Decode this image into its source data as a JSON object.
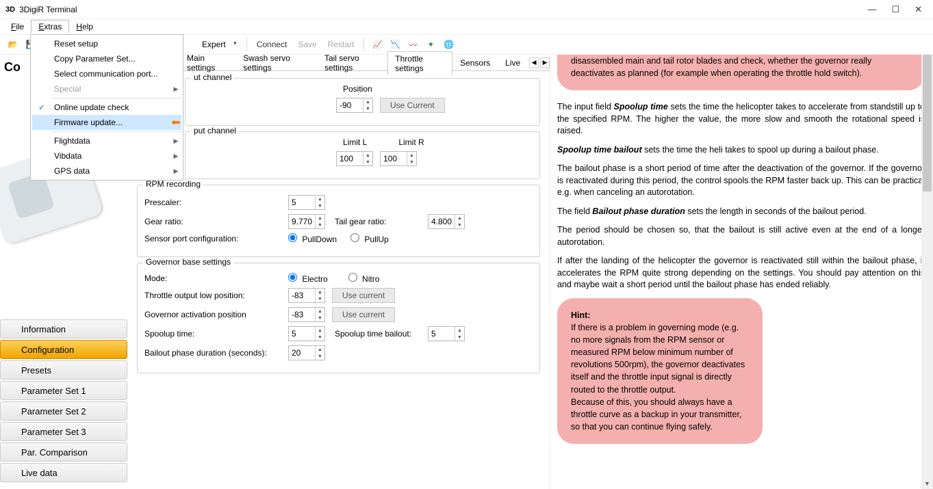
{
  "window": {
    "title": "3DigiR Terminal",
    "logo": "3D"
  },
  "menubar": {
    "file": "File",
    "extras": "Extras",
    "help": "Help"
  },
  "dropdown": {
    "reset": "Reset setup",
    "copy": "Copy Parameter Set...",
    "port": "Select communication port...",
    "special": "Special",
    "update_check": "Online update check",
    "firmware": "Firmware update...",
    "flight": "Flightdata",
    "vib": "Vibdata",
    "gps": "GPS data"
  },
  "toolbar": {
    "mode": "Expert",
    "connect": "Connect",
    "save": "Save",
    "restart": "Restart"
  },
  "cfg_label": "Co",
  "nav": {
    "info": "Information",
    "config": "Configuration",
    "presets": "Presets",
    "ps1": "Parameter Set 1",
    "ps2": "Parameter Set 2",
    "ps3": "Parameter Set 3",
    "parcomp": "Par. Comparison",
    "live": "Live data"
  },
  "tabs": {
    "main": "Main settings",
    "swash": "Swash servo settings",
    "tail": "Tail servo settings",
    "throttle": "Throttle settings",
    "sensors": "Sensors",
    "live": "Live"
  },
  "form": {
    "in_channel": "ut channel",
    "position_lbl": "Position",
    "position_val": "-90",
    "use_current_1": "Use Current",
    "out_channel": "put channel",
    "limit_l_lbl": "Limit L",
    "limit_r_lbl": "Limit R",
    "limit_l": "100",
    "limit_r": "100",
    "rpm_rec": "RPM recording",
    "prescaler_lbl": "Prescaler:",
    "prescaler": "5",
    "gear_lbl": "Gear ratio:",
    "gear": "9.770",
    "tail_gear_lbl": "Tail gear ratio:",
    "tail_gear": "4.800",
    "sensor_port_lbl": "Sensor port configuration:",
    "pulldown": "PullDown",
    "pullup": "PullUp",
    "gov_base": "Governor base settings",
    "mode_lbl": "Mode:",
    "electro": "Electro",
    "nitro": "Nitro",
    "throttle_low_lbl": "Throttle output low position:",
    "throttle_low": "-83",
    "use_current_2": "Use current",
    "gov_act_lbl": "Governor activation position",
    "gov_act": "-83",
    "use_current_3": "Use current",
    "spoolup_lbl": "Spoolup time:",
    "spoolup": "5",
    "spoolup_bail_lbl": "Spoolup time bailout:",
    "spoolup_bail": "5",
    "bailout_dur_lbl": "Bailout phase duration (seconds):",
    "bailout_dur": "20"
  },
  "help": {
    "warn_top": "disassembled main and tail rotor blades and check, whether the governor really deactivates as planned (for example when operating the throttle hold switch).",
    "p1a": "The input field ",
    "p1b": "Spoolup time",
    "p1c": " sets the time the helicopter takes to accelerate from standstill up to the specified RPM. The higher the value, the more slow and smooth the rotational speed is raised.",
    "p2a": "Spoolup time bailout",
    "p2b": " sets the time the heli takes to spool up during a bailout phase.",
    "p3": "The bailout phase is a short period of time after the deactivation of the governor. If the governor is reactivated during this period, the control spools the RPM faster back up. This can be practical e.g. when canceling an autorotation.",
    "p4a": "The field ",
    "p4b": "Bailout phase duration",
    "p4c": " sets the length in seconds of the bailout period.",
    "p5": "The period should be chosen so, that the bailout is still active even at the end of a longer autorotation.",
    "p6": "If after the landing of the helicopter the governor is reactivated still within the bailout phase, it accelerates the RPM quite strong depending on the settings. You should pay attention on this and maybe wait a short period until the bailout phase has ended reliably.",
    "hint_title": "Hint:",
    "hint_body1": "If there is a problem in governing mode (e.g. no more signals from the RPM sensor or measured RPM below minimum number of revolutions 500rpm), the governor deactivates itself and the throttle input signal is directly routed to the throttle output.",
    "hint_body2": "Because of this, you should always have a throttle curve as a backup in your transmitter, so that you can continue flying safely."
  }
}
